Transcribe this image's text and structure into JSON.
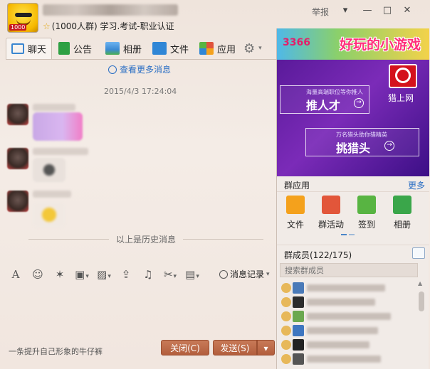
{
  "header": {
    "badge": "1000",
    "subtitle": "(1000人群) 学习.考试-职业认证",
    "report": "举报",
    "win_buttons": {
      "dropdown": "▾",
      "minimize": "—",
      "maximize": "□",
      "close": "✕"
    }
  },
  "tabs": [
    {
      "label": "聊天",
      "icon": "chat-icon",
      "color": "#3a86d0",
      "active": true
    },
    {
      "label": "公告",
      "icon": "announcement-icon",
      "color": "#2ea043"
    },
    {
      "label": "相册",
      "icon": "photo-icon",
      "color": "#3b8ad3"
    },
    {
      "label": "文件",
      "icon": "folder-icon",
      "color": "#2f86d6"
    },
    {
      "label": "应用",
      "icon": "apps-icon",
      "color": "#e0533b"
    }
  ],
  "chat": {
    "more_messages": "查看更多消息",
    "timestamp": "2015/4/3 17:24:04",
    "history_separator": "以上是历史消息"
  },
  "toolbar": {
    "icons": [
      "font-icon",
      "emoji-icon",
      "magic-icon",
      "gift-icon",
      "image-icon",
      "upload-icon",
      "music-icon",
      "scissors-icon",
      "screen-icon"
    ],
    "message_record": "消息记录"
  },
  "footer": {
    "signature": "一条提升自己形象的牛仔裤",
    "close_button": "关闭(C)",
    "send_button": "发送(S)",
    "send_dropdown": "▾"
  },
  "right_panel": {
    "ad_top": {
      "logo": "3366",
      "slogan": "好玩的小游戏"
    },
    "ad_main": {
      "brand": "猎上网",
      "card1_small": "海量高端职位等你推人",
      "card1_big": "推人才",
      "card2_small": "万名猎头助你猎精英",
      "card2_big": "挑猎头"
    },
    "group_apps": {
      "title": "群应用",
      "more": "更多",
      "items": [
        {
          "label": "文件",
          "icon": "folder-icon",
          "color": "#f4a11c"
        },
        {
          "label": "群活动",
          "icon": "event-icon",
          "color": "#e2563a"
        },
        {
          "label": "签到",
          "icon": "checkin-icon",
          "color": "#58b442"
        },
        {
          "label": "相册",
          "icon": "photo-icon",
          "color": "#3aa64a"
        }
      ]
    },
    "members": {
      "title": "群成员(122/175)",
      "search_placeholder": "搜索群成员"
    }
  }
}
